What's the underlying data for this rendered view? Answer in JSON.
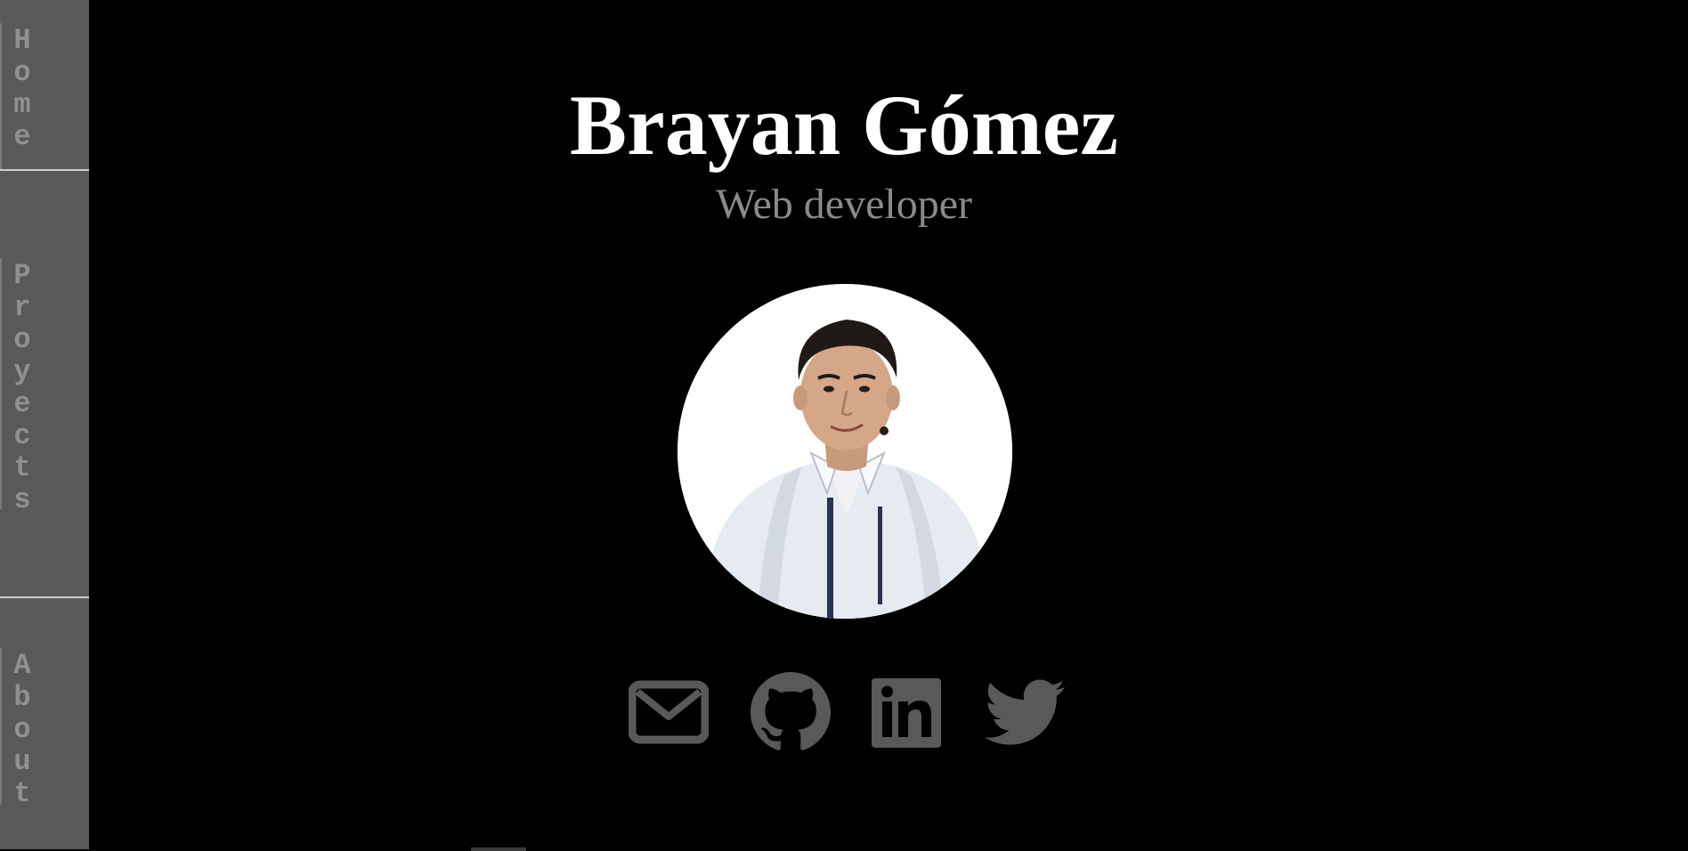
{
  "nav": {
    "items": [
      {
        "label": "Home"
      },
      {
        "label": "Proyects"
      },
      {
        "label": "About"
      }
    ]
  },
  "hero": {
    "name": "Brayan Gómez",
    "role": "Web developer"
  },
  "social": {
    "links": [
      {
        "icon": "envelope-icon",
        "name": "email"
      },
      {
        "icon": "github-icon",
        "name": "github"
      },
      {
        "icon": "linkedin-icon",
        "name": "linkedin"
      },
      {
        "icon": "twitter-icon",
        "name": "twitter"
      }
    ],
    "icon_color": "#595959"
  },
  "colors": {
    "background": "#000000",
    "sidebar": "#595959",
    "name": "#ffffff",
    "role": "#8a8a8a"
  }
}
